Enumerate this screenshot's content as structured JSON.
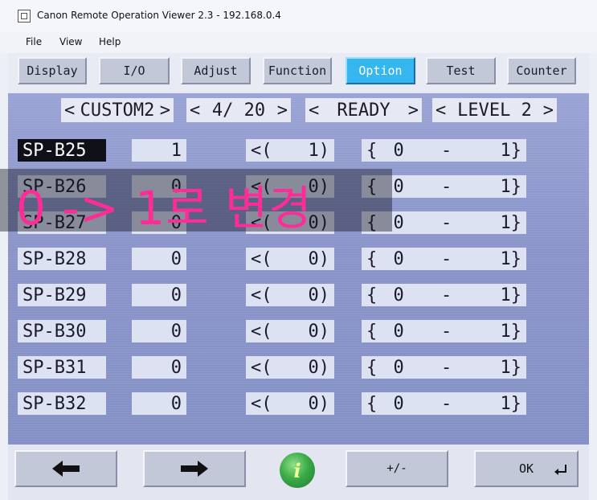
{
  "window": {
    "title": "Canon Remote Operation Viewer 2.3 - 192.168.0.4"
  },
  "menu": [
    {
      "label": "File"
    },
    {
      "label": "View"
    },
    {
      "label": "Help"
    }
  ],
  "tabs": [
    {
      "label": "Display"
    },
    {
      "label": "I/O"
    },
    {
      "label": "Adjust"
    },
    {
      "label": "Function"
    },
    {
      "label": "Option",
      "active": true
    },
    {
      "label": "Test"
    },
    {
      "label": "Counter"
    }
  ],
  "header": {
    "group": {
      "left": "<",
      "label": "CUSTOM2",
      "right": ">"
    },
    "page": {
      "left": "<",
      "label": "4/ 20",
      "right": ">"
    },
    "status": {
      "left": "<",
      "label": "READY",
      "right": ">"
    },
    "level": {
      "left": "<",
      "label": "LEVEL 2",
      "right": ">"
    }
  },
  "rows": [
    {
      "name": "SP-B25",
      "value": "1",
      "ref_open": "<(",
      "ref_value": "1)",
      "range_open": "{",
      "range_min": "0",
      "range_sep": "-",
      "range_max": "1}",
      "selected": true
    },
    {
      "name": "SP-B26",
      "value": "0",
      "ref_open": "<(",
      "ref_value": "0)",
      "range_open": "{",
      "range_min": "0",
      "range_sep": "-",
      "range_max": "1}"
    },
    {
      "name": "SP-B27",
      "value": "0",
      "ref_open": "<(",
      "ref_value": "0)",
      "range_open": "{",
      "range_min": "0",
      "range_sep": "-",
      "range_max": "1}"
    },
    {
      "name": "SP-B28",
      "value": "0",
      "ref_open": "<(",
      "ref_value": "0)",
      "range_open": "{",
      "range_min": "0",
      "range_sep": "-",
      "range_max": "1}"
    },
    {
      "name": "SP-B29",
      "value": "0",
      "ref_open": "<(",
      "ref_value": "0)",
      "range_open": "{",
      "range_min": "0",
      "range_sep": "-",
      "range_max": "1}"
    },
    {
      "name": "SP-B30",
      "value": "0",
      "ref_open": "<(",
      "ref_value": "0)",
      "range_open": "{",
      "range_min": "0",
      "range_sep": "-",
      "range_max": "1}"
    },
    {
      "name": "SP-B31",
      "value": "0",
      "ref_open": "<(",
      "ref_value": "0)",
      "range_open": "{",
      "range_min": "0",
      "range_sep": "-",
      "range_max": "1}"
    },
    {
      "name": "SP-B32",
      "value": "0",
      "ref_open": "<(",
      "ref_value": "0)",
      "range_open": "{",
      "range_min": "0",
      "range_sep": "-",
      "range_max": "1}"
    }
  ],
  "overlay": {
    "text": "0 -> 1로 변경"
  },
  "footer": {
    "back_icon": "arrow-left-icon",
    "forward_icon": "arrow-right-icon",
    "info_label": "i",
    "plusminus_label": "+/-",
    "ok_label": "OK",
    "enter_icon": "enter-return-icon"
  },
  "colors": {
    "active_tab": "#35b6ee",
    "overlay_text": "#ff2c98",
    "info_button": "#3bab47"
  }
}
